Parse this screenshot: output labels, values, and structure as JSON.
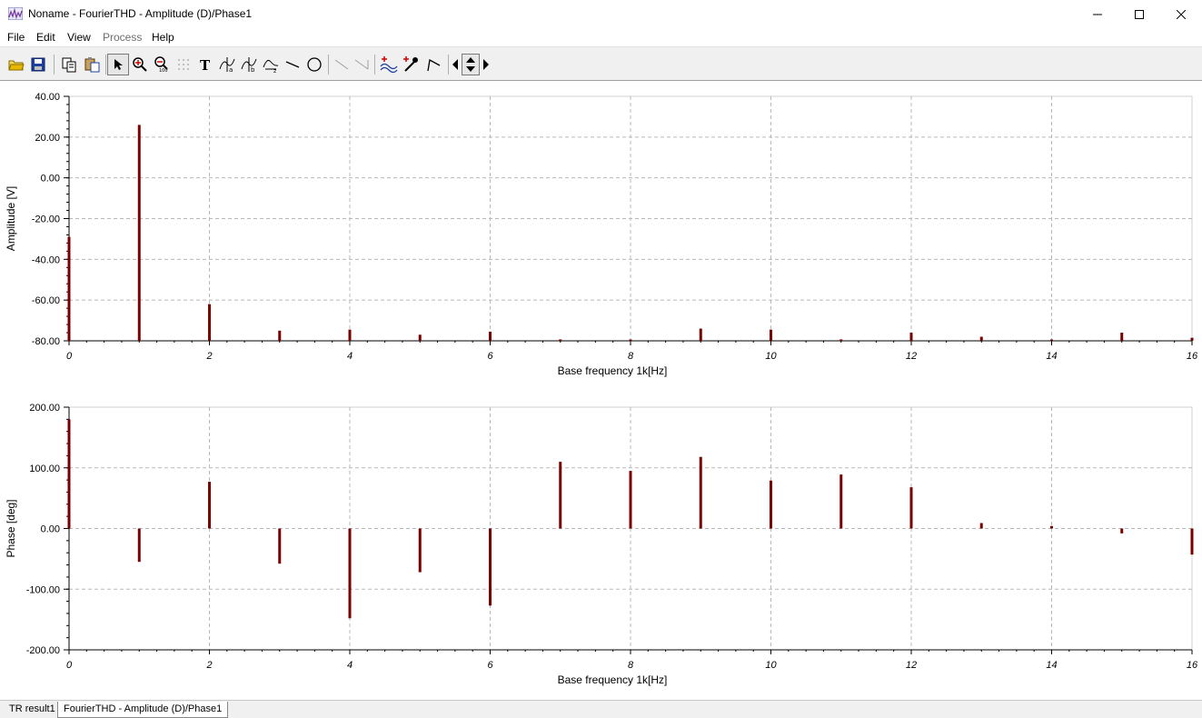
{
  "window": {
    "title": "Noname - FourierTHD - Amplitude (D)/Phase1",
    "minimize_icon": "minimize-icon",
    "maximize_icon": "maximize-icon",
    "close_icon": "close-icon"
  },
  "menu": {
    "items": [
      {
        "label": "File",
        "enabled": true
      },
      {
        "label": "Edit",
        "enabled": true
      },
      {
        "label": "View",
        "enabled": true
      },
      {
        "label": "Process",
        "enabled": false
      },
      {
        "label": "Help",
        "enabled": true
      }
    ]
  },
  "toolbar": {
    "buttons": [
      "open-folder-icon",
      "save-icon",
      "copy-icon",
      "paste-icon",
      "pointer-icon",
      "zoom-in-icon",
      "zoom-100-icon",
      "grid-icon",
      "text-icon",
      "cursor-a-icon",
      "cursor-b-icon",
      "cursor-peak-icon",
      "line-icon",
      "circle-icon",
      "diagonal-disabled-icon",
      "diagonal2-disabled-icon",
      "add-curve-icon",
      "pick-color-icon",
      "marker-icon",
      "arrow-left-icon",
      "arrow-updown-icon",
      "arrow-right-icon"
    ]
  },
  "colors": {
    "bar": "#7a0000",
    "grid": "#b8b8b8",
    "toolbar_bg": "#f0f0f0"
  },
  "chart_data": [
    {
      "type": "bar",
      "xlabel": "Base frequency 1k[Hz]",
      "ylabel": "Amplitude [V]",
      "xlim": [
        0,
        16
      ],
      "ylim": [
        -80,
        40
      ],
      "xticks": [
        0,
        2,
        4,
        6,
        8,
        10,
        12,
        14,
        16
      ],
      "yticks": [
        "40.00",
        "20.00",
        "0.00",
        "-20.00",
        "-40.00",
        "-60.00",
        "-80.00"
      ],
      "grid": true,
      "baseline": -80,
      "x": [
        0,
        1,
        2,
        3,
        4,
        5,
        6,
        7,
        8,
        9,
        10,
        11,
        12,
        13,
        14,
        15,
        16
      ],
      "values": [
        -29,
        26,
        -62,
        -75,
        -74.5,
        -77,
        -75.5,
        -79.3,
        -80,
        -74,
        -74.5,
        -79.3,
        -76,
        -78,
        -80,
        -76,
        -78.5
      ]
    },
    {
      "type": "bar",
      "xlabel": "Base frequency 1k[Hz]",
      "ylabel": "Phase [deg]",
      "xlim": [
        0,
        16
      ],
      "ylim": [
        -200,
        200
      ],
      "xticks": [
        0,
        2,
        4,
        6,
        8,
        10,
        12,
        14,
        16
      ],
      "yticks": [
        "200.00",
        "100.00",
        "0.00",
        "-100.00",
        "-200.00"
      ],
      "grid": true,
      "baseline": 0,
      "x": [
        0,
        1,
        2,
        3,
        4,
        5,
        6,
        7,
        8,
        9,
        10,
        11,
        12,
        13,
        14,
        15,
        16
      ],
      "values": [
        180,
        -55,
        77,
        -58,
        -148,
        -72,
        -127,
        110,
        95,
        118,
        79,
        89,
        68,
        9,
        4,
        -8,
        -43
      ]
    }
  ],
  "tabs": [
    {
      "label": "TR result1",
      "active": false
    },
    {
      "label": "FourierTHD - Amplitude (D)/Phase1",
      "active": true
    }
  ]
}
